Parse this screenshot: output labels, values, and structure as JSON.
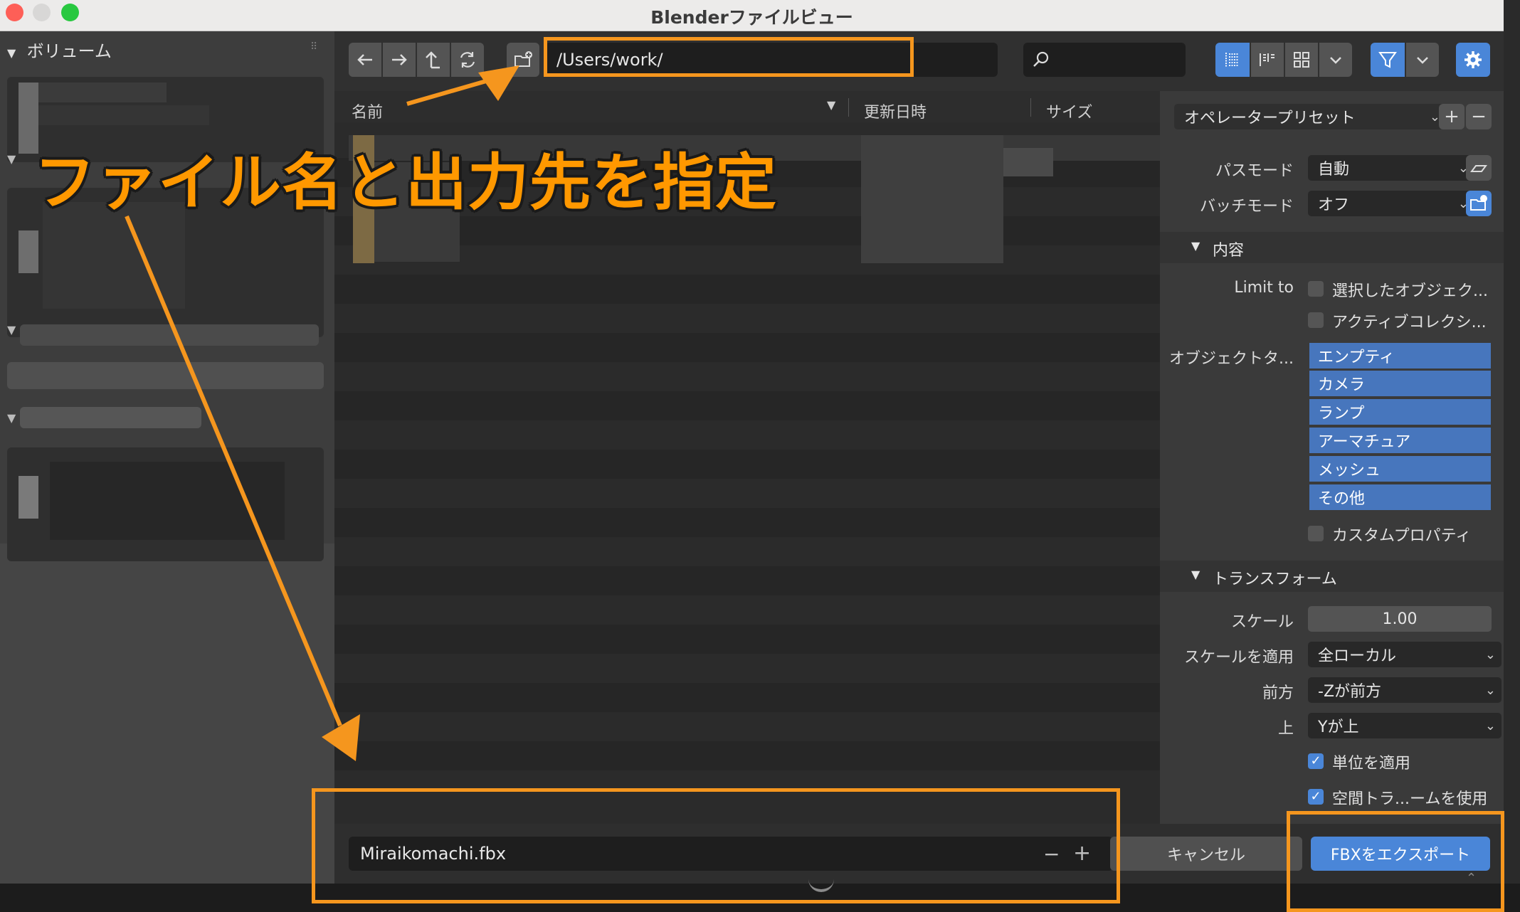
{
  "window": {
    "title": "Blenderファイルビュー"
  },
  "colors": {
    "accent": "#4a86d8",
    "annotation": "#f5961e",
    "traffic_close": "#fe5f57",
    "traffic_min": "#d8d7d6",
    "traffic_max": "#28c840"
  },
  "sidebar": {
    "volumes_header": "ボリューム"
  },
  "toolbar": {
    "path": "/Users/work/",
    "icons": [
      "back-arrow-icon",
      "forward-arrow-icon",
      "parent-directory-icon",
      "refresh-icon",
      "new-folder-icon",
      "search-icon",
      "vertical-list-icon",
      "horizontal-list-icon",
      "thumbnail-icon",
      "chevron-down-icon",
      "filter-icon",
      "chevron-down-icon",
      "gear-icon"
    ]
  },
  "filelist": {
    "columns": [
      "名前",
      "更新日時",
      "サイズ"
    ]
  },
  "right_panel": {
    "operator_preset": "オペレータープリセット",
    "path_mode_label": "パスモード",
    "path_mode_value": "自動",
    "batch_mode_label": "バッチモード",
    "batch_mode_value": "オフ",
    "include_section": "内容",
    "limit_to_label": "Limit to",
    "selected_objects": "選択したオブジェク...",
    "active_collection": "アクティブコレクシ...",
    "object_types_label": "オブジェクトタ...",
    "object_types": [
      "エンプティ",
      "カメラ",
      "ランプ",
      "アーマチュア",
      "メッシュ",
      "その他"
    ],
    "custom_properties": "カスタムプロパティ",
    "transform_section": "トランスフォーム",
    "scale_label": "スケール",
    "scale_value": "1.00",
    "apply_scaling_label": "スケールを適用",
    "apply_scaling_value": "全ローカル",
    "forward_label": "前方",
    "forward_value": "-Zが前方",
    "up_label": "上",
    "up_value": "Yが上",
    "apply_unit": "単位を適用",
    "use_space_transform": "空間トラ...ームを使用"
  },
  "footer": {
    "filename": "Miraikomachi.fbx",
    "cancel": "キャンセル",
    "export": "FBXをエクスポート"
  },
  "annotation": {
    "text": "ファイル名と出力先を指定"
  }
}
